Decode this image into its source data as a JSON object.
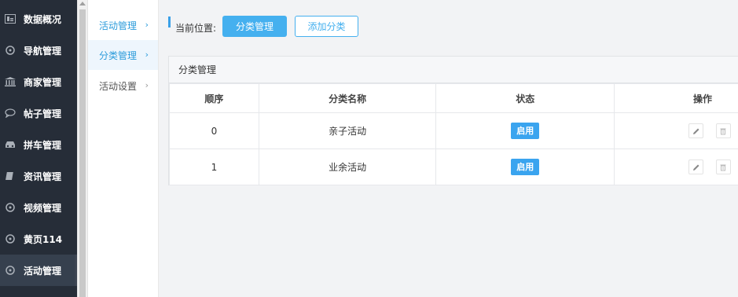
{
  "sidebar": {
    "items": [
      {
        "label": "数据概况",
        "icon": "chart-icon"
      },
      {
        "label": "导航管理",
        "icon": "compass-icon"
      },
      {
        "label": "商家管理",
        "icon": "bank-icon"
      },
      {
        "label": "帖子管理",
        "icon": "comment-icon"
      },
      {
        "label": "拼车管理",
        "icon": "car-icon"
      },
      {
        "label": "资讯管理",
        "icon": "book-icon"
      },
      {
        "label": "视频管理",
        "icon": "compass-icon"
      },
      {
        "label": "黄页114",
        "icon": "compass-icon"
      },
      {
        "label": "活动管理",
        "icon": "compass-icon",
        "active": true
      }
    ]
  },
  "submenu": {
    "items": [
      {
        "label": "活动管理",
        "arrow": "›"
      },
      {
        "label": "分类管理",
        "arrow": "›"
      },
      {
        "label": "活动设置",
        "arrow": "›"
      }
    ]
  },
  "breadcrumb": {
    "label": "当前位置:",
    "current_button": "分类管理",
    "add_button": "添加分类"
  },
  "panel": {
    "title": "分类管理",
    "columns": [
      "顺序",
      "分类名称",
      "状态",
      "操作"
    ],
    "rows": [
      {
        "order": "0",
        "name": "亲子活动",
        "status": "启用"
      },
      {
        "order": "1",
        "name": "业余活动",
        "status": "启用"
      }
    ]
  },
  "colors": {
    "sidebar_bg": "#262d38",
    "accent": "#45b0ef",
    "status_bg": "#3aa4ef"
  }
}
